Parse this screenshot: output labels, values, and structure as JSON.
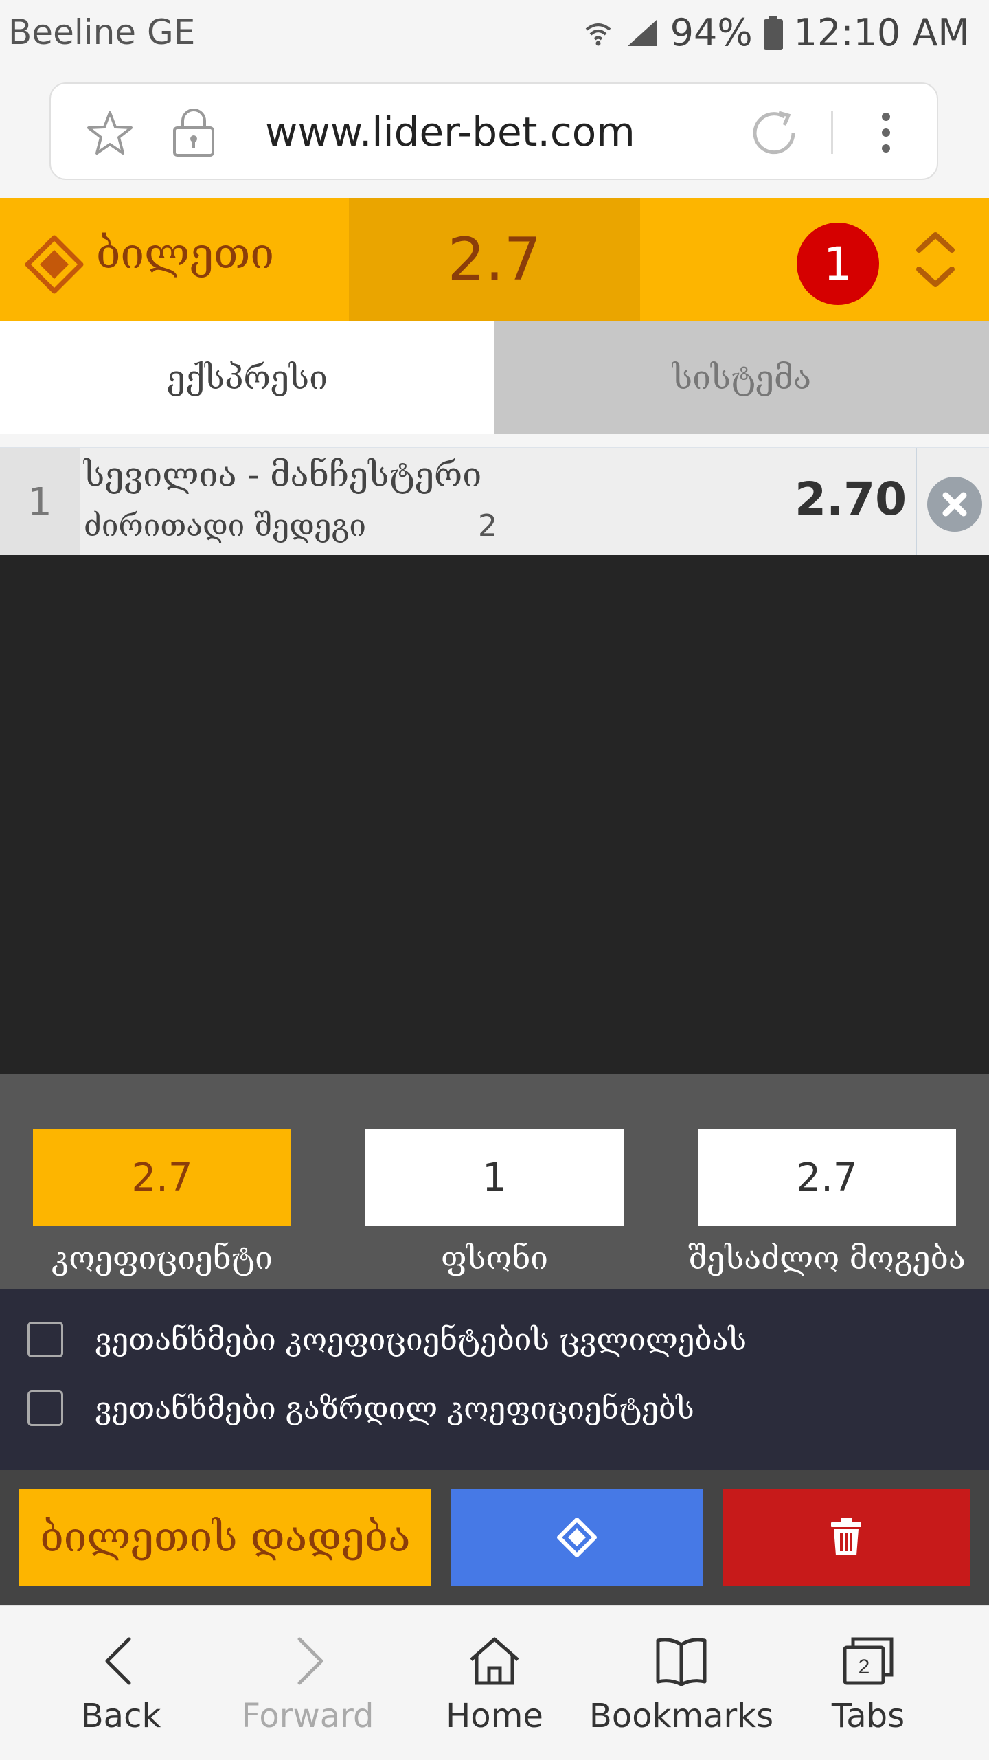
{
  "status_bar": {
    "carrier": "Beeline GE",
    "battery": "94%",
    "time": "12:10 AM"
  },
  "browser": {
    "url": "www.lider-bet.com"
  },
  "ticket_header": {
    "title": "ბილეთი",
    "total_odds": "2.7",
    "count": "1"
  },
  "tabs": [
    {
      "label": "ექსპრესი",
      "active": true
    },
    {
      "label": "სისტემა",
      "active": false
    }
  ],
  "bet": {
    "index": "1",
    "match": "სევილია - მანჩესტერი",
    "market": "ძირითადი შედეგი",
    "outcome": "2",
    "odds": "2.70"
  },
  "totals": {
    "coefficient_value": "2.7",
    "coefficient_label": "კოეფიციენტი",
    "stake_value": "1",
    "stake_label": "ფსონი",
    "possible_win_value": "2.7",
    "possible_win_label": "შესაძლო მოგება"
  },
  "agreements": [
    {
      "label": "ვეთანხმები კოეფიციენტების ცვლილებას",
      "checked": false
    },
    {
      "label": "ვეთანხმები გაზრდილ კოეფიციენტებს",
      "checked": false
    }
  ],
  "actions": {
    "place_bet_label": "ბილეთის დადება"
  },
  "bottom_nav": {
    "back": "Back",
    "forward": "Forward",
    "home": "Home",
    "bookmarks": "Bookmarks",
    "tabs": "Tabs",
    "tabs_count": "2"
  },
  "colors": {
    "accent_orange": "#fdb500",
    "accent_orange_dark": "#eaa500",
    "text_brown": "#8b3d0a",
    "badge_red": "#d50000",
    "blue_button": "#4679e6",
    "red_button": "#c71a1a",
    "agreement_bg": "#2b2c3b"
  }
}
